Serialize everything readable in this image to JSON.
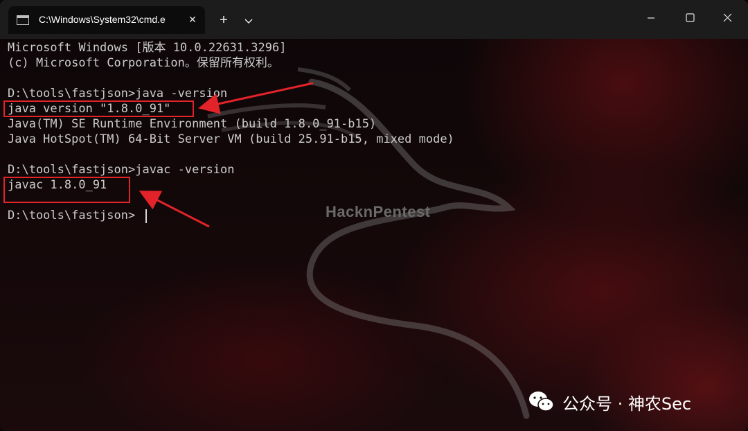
{
  "window": {
    "tab_title": "C:\\Windows\\System32\\cmd.e",
    "tab_icon": "terminal-icon",
    "close_tab_glyph": "✕",
    "new_tab_glyph": "+",
    "dropdown_icon": "chevron-down-icon",
    "controls": [
      "minimize-icon",
      "maximize-icon",
      "close-icon"
    ]
  },
  "terminal": {
    "lines": [
      "Microsoft Windows [版本 10.0.22631.3296]",
      "(c) Microsoft Corporation。保留所有权利。",
      "",
      "D:\\tools\\fastjson>java -version",
      "java version \"1.8.0_91\"",
      "Java(TM) SE Runtime Environment (build 1.8.0_91-b15)",
      "Java HotSpot(TM) 64-Bit Server VM (build 25.91-b15, mixed mode)",
      "",
      "D:\\tools\\fastjson>javac -version",
      "javac 1.8.0_91",
      "",
      "D:\\tools\\fastjson>"
    ]
  },
  "background": {
    "watermark": "HacknPentest",
    "accent_color": "#e2232a"
  },
  "footer": {
    "icon": "wechat-icon",
    "text": "公众号 · 神农Sec"
  }
}
